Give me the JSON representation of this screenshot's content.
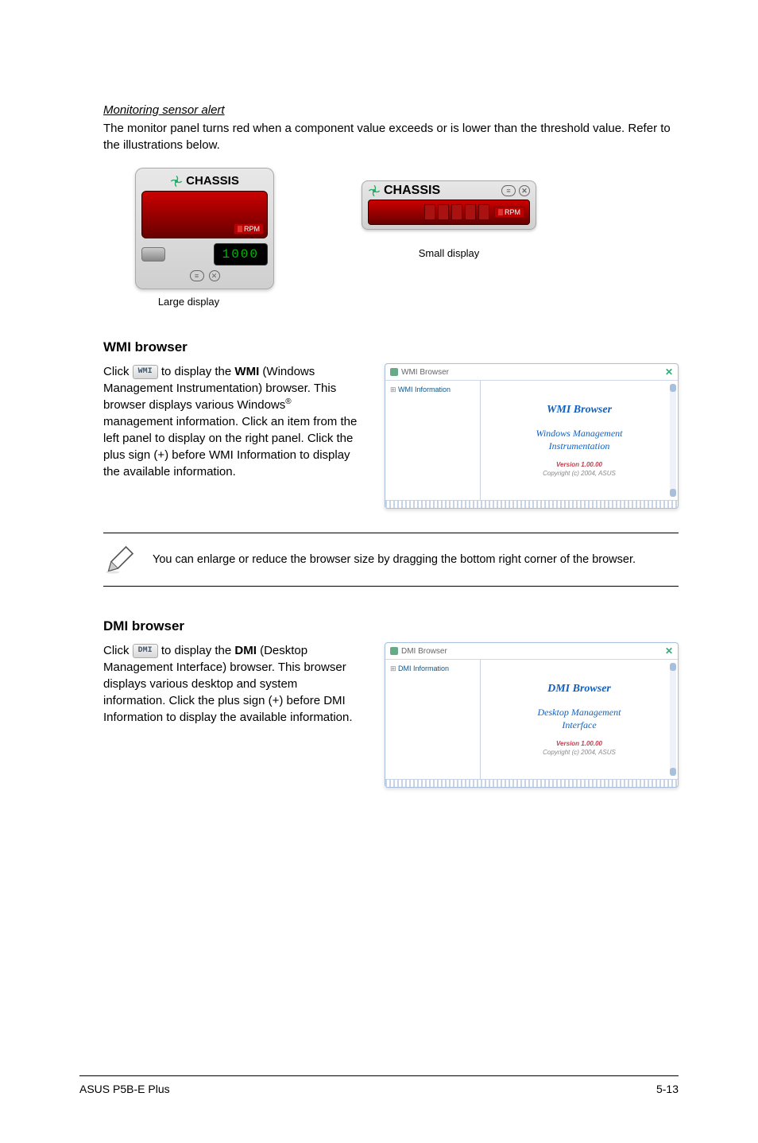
{
  "section1": {
    "subheading": "Monitoring sensor alert",
    "body": "The monitor panel turns red when a component value exceeds or is lower than the threshold value. Refer to the illustrations below.",
    "large_panel": {
      "label": "CHASSIS",
      "rpm_label": "RPM",
      "digits": "1000",
      "caption": "Large display"
    },
    "small_panel": {
      "label": "CHASSIS",
      "rpm_label": "RPM",
      "caption": "Small display"
    }
  },
  "wmi": {
    "heading": "WMI browser",
    "click": "Click ",
    "btn_label": "WMI",
    "after_btn": " to display the ",
    "bold1": "WMI",
    "body_rest": " (Windows Management Instrumentation) browser. This browser displays various Windows",
    "sup": "®",
    "body_rest2": " management information. Click an item from the left panel to display on the right panel. Click the plus sign (+) before WMI Information to display the available information.",
    "window": {
      "title": "WMI Browser",
      "tree_item": "WMI Information",
      "pane_title": "WMI Browser",
      "pane_sub1": "Windows Management",
      "pane_sub2": "Instrumentation",
      "version": "Version 1.00.00",
      "copyright": "Copyright (c) 2004, ASUS"
    }
  },
  "note": {
    "text": "You can enlarge or reduce the browser size by dragging the bottom right corner of the browser."
  },
  "dmi": {
    "heading": "DMI browser",
    "click": "Click ",
    "btn_label": "DMI",
    "after_btn": " to display the ",
    "bold1": "DMI",
    "body_rest": " (Desktop Management Interface) browser. This browser displays various desktop and system information. Click the plus sign (+) before DMI Information to display the available information.",
    "window": {
      "title": "DMI Browser",
      "tree_item": "DMI Information",
      "pane_title": "DMI Browser",
      "pane_sub1": "Desktop Management",
      "pane_sub2": "Interface",
      "version": "Version 1.00.00",
      "copyright": "Copyright (c) 2004, ASUS"
    }
  },
  "footer": {
    "left": "ASUS P5B-E Plus",
    "right": "5-13"
  }
}
